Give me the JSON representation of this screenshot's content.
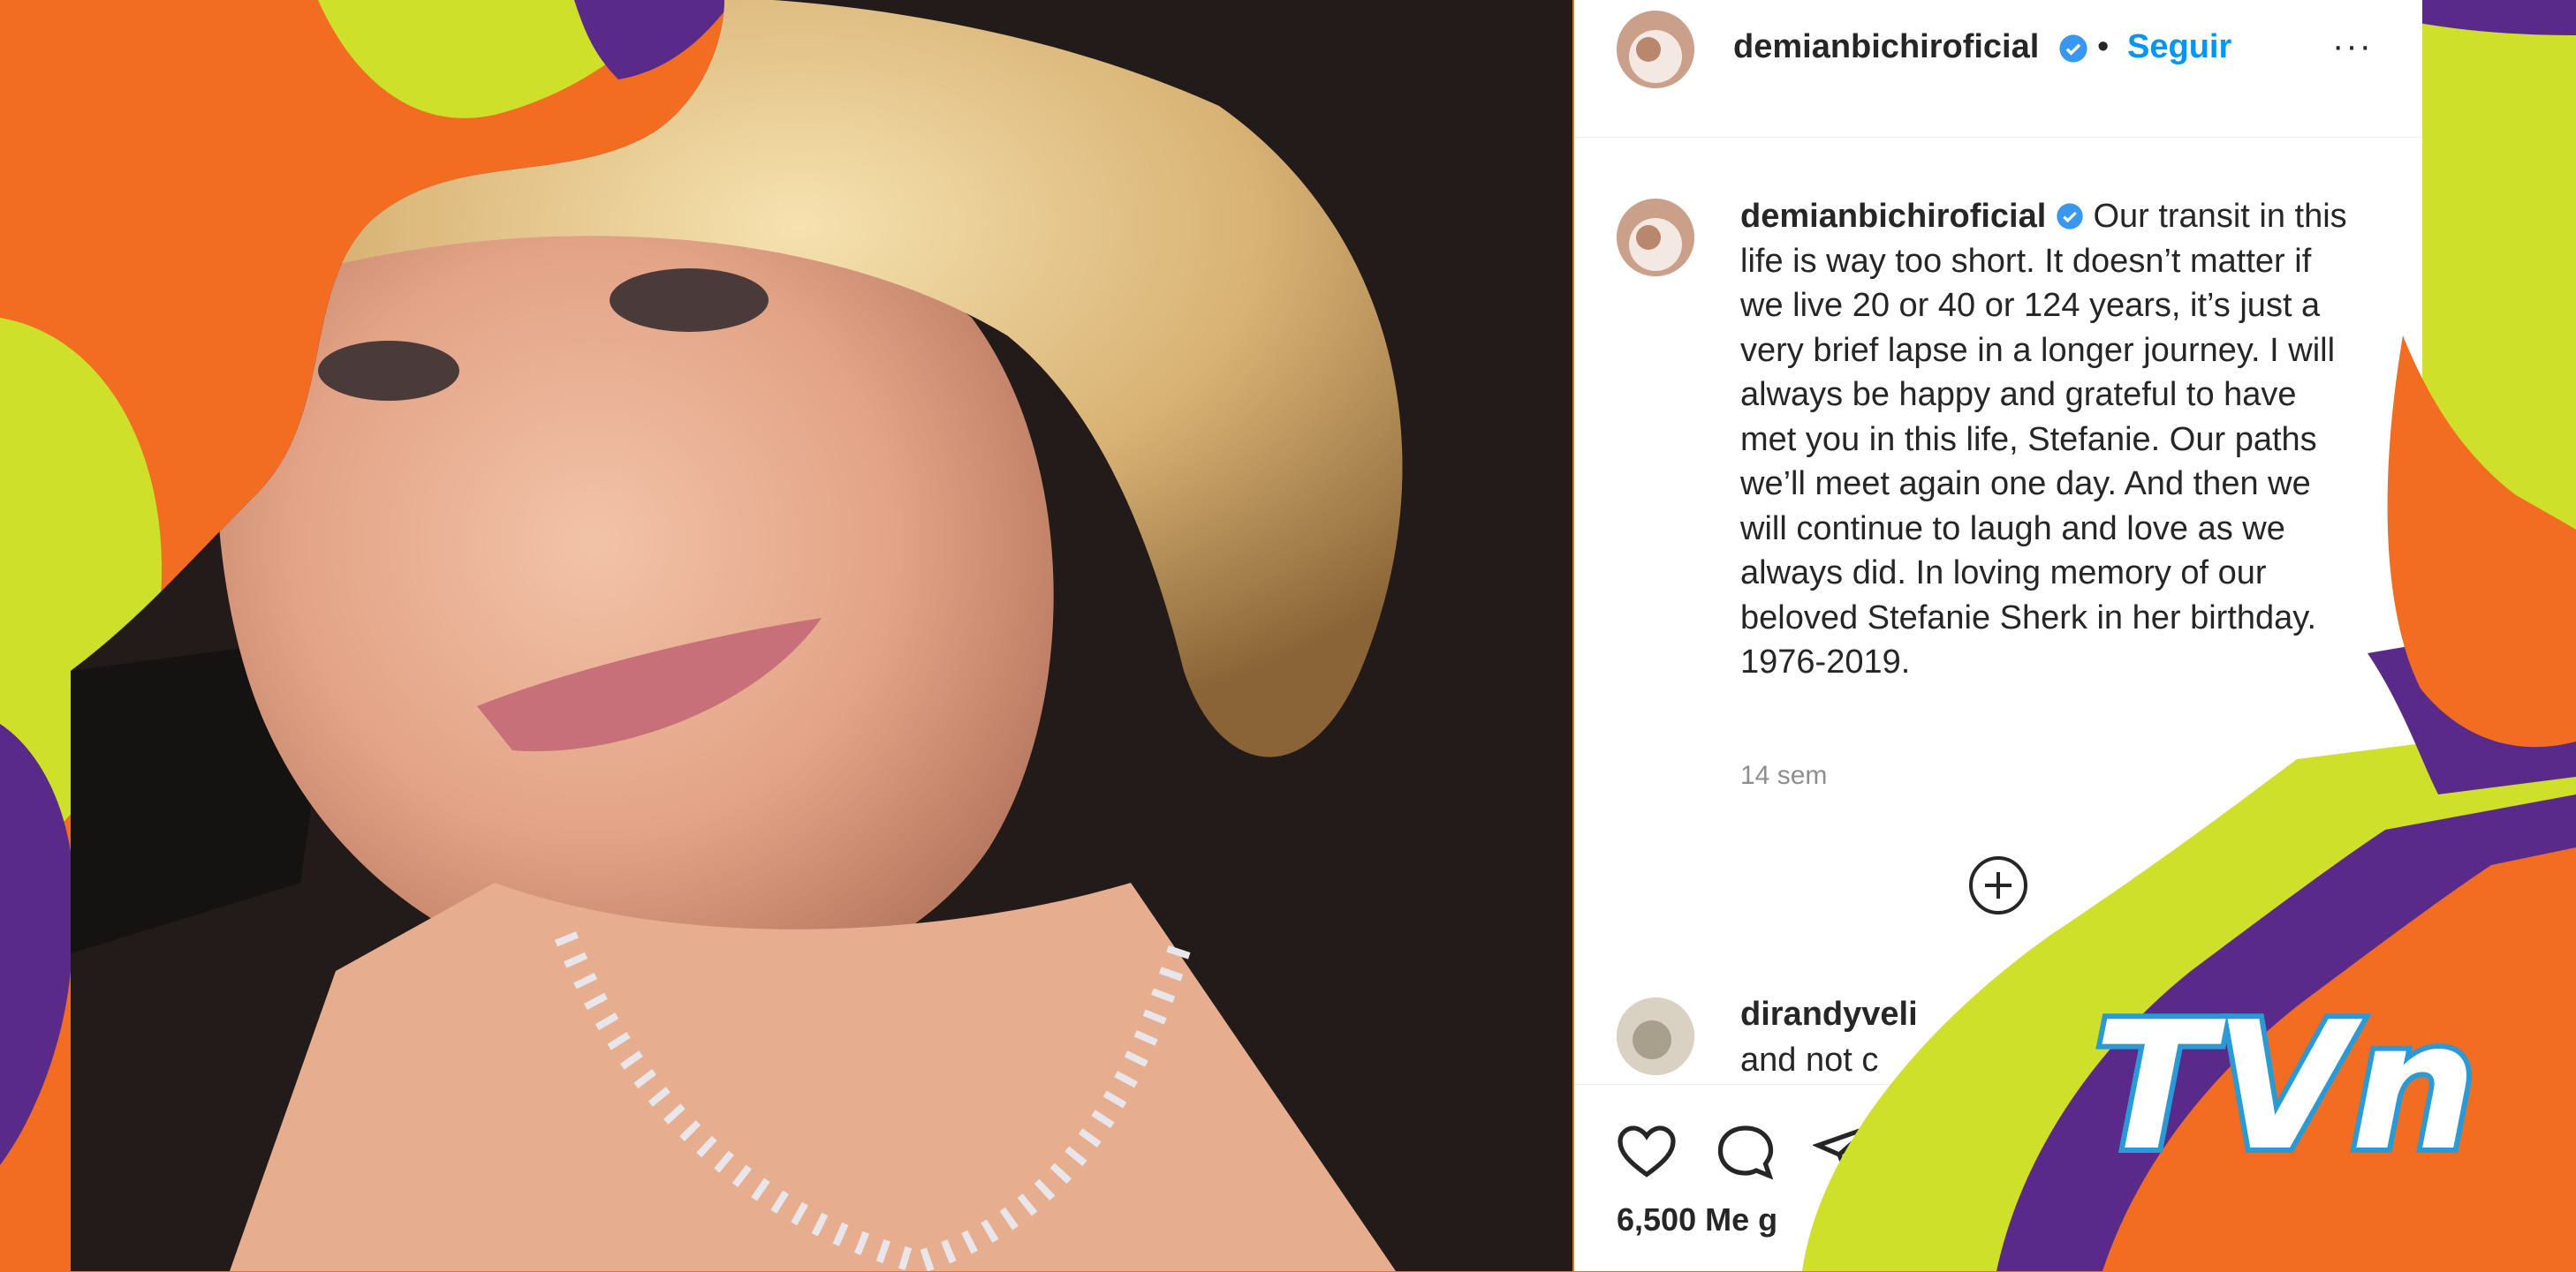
{
  "post": {
    "username": "demianbichiroficial",
    "separator": "•",
    "follow_label": "Seguir",
    "more_label": "···",
    "caption_text": "Our transit in this life is way too short. It doesn’t matter if we live 20 or 40 or 124 years, it’s just a very brief lapse in a longer journey. I will always be happy and grateful to have met you in this life, Stefanie. Our paths we’ll meet again one day. And then we will continue to laugh and love as we always did. In loving memory of our beloved Stefanie Sherk in her birthday. 1976-2019.",
    "time_ago": "14 sem",
    "comment_username": "dirandyveli",
    "comment_text": "and not c",
    "likes": "6,500 Me g"
  },
  "logo_text": "TVn",
  "colors": {
    "orange": "#f26d21",
    "lime": "#cfe02a",
    "purple": "#5a2a8a",
    "instagram_blue": "#0095f6"
  },
  "icons": {
    "verified": "verified-badge-icon",
    "add_comment": "plus-circle-icon",
    "like": "heart-icon",
    "comment": "comment-bubble-icon",
    "share": "paper-plane-icon"
  }
}
